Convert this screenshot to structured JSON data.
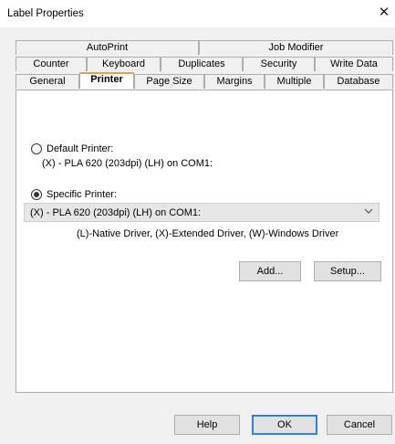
{
  "window": {
    "title": "Label Properties",
    "close_glyph": "✕"
  },
  "tabs": {
    "row1": [
      "AutoPrint",
      "Job Modifier"
    ],
    "row2": [
      "Counter",
      "Keyboard",
      "Duplicates",
      "Security",
      "Write Data"
    ],
    "row3": [
      "General",
      "Printer",
      "Page Size",
      "Margins",
      "Multiple",
      "Database"
    ],
    "selected": "Printer"
  },
  "printer_tab": {
    "default_printer": {
      "label": "Default Printer:",
      "value": "(X) - PLA 620 (203dpi) (LH) on COM1:",
      "checked": false
    },
    "specific_printer": {
      "label": "Specific Printer:",
      "checked": true,
      "selected_value": "(X) - PLA 620 (203dpi) (LH) on COM1:",
      "legend": "(L)-Native Driver, (X)-Extended Driver, (W)-Windows Driver"
    },
    "add_button": "Add...",
    "setup_button": "Setup..."
  },
  "footer": {
    "help": "Help",
    "ok": "OK",
    "cancel": "Cancel"
  },
  "icons": {
    "dropdown": "chevron-down-icon",
    "close": "close-icon"
  },
  "colors": {
    "selected_tab_accent": "#e6a046",
    "default_button_border": "#2f82d6"
  }
}
